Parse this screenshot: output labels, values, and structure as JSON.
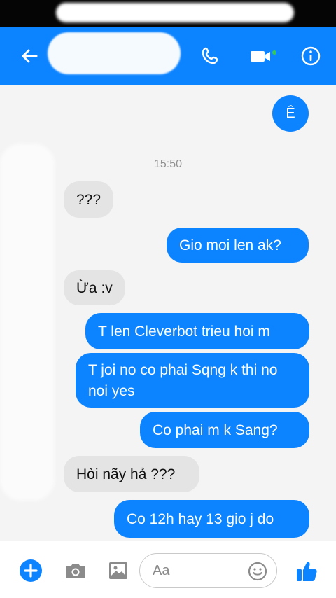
{
  "header": {
    "back_icon": "arrow-left-icon",
    "contact_name": "",
    "actions": [
      "phone-icon",
      "video-icon",
      "info-icon"
    ]
  },
  "conversation": {
    "top_bubble": "Ê",
    "timestamp": "15:50",
    "messages": [
      {
        "direction": "in",
        "text": "???"
      },
      {
        "direction": "out",
        "text": "Gio moi len ak?"
      },
      {
        "direction": "in",
        "text": "Ừa :v"
      },
      {
        "direction": "out",
        "text": "T len Cleverbot trieu hoi m"
      },
      {
        "direction": "out",
        "text": "T joi no co phai Sqng k thi no noi yes"
      },
      {
        "direction": "out",
        "text": "Co phai m k Sang?"
      },
      {
        "direction": "in",
        "text": "Hòi nãy hả ???"
      },
      {
        "direction": "out",
        "text": "Co 12h hay 13 gio j do"
      }
    ]
  },
  "composer": {
    "placeholder": "Aa",
    "icons": [
      "plus-icon",
      "camera-icon",
      "image-icon",
      "emoji-icon",
      "thumbs-up-icon"
    ]
  },
  "colors": {
    "accent": "#0d84ff",
    "incoming_bubble": "#e4e4e4",
    "background": "#f4f4f4"
  }
}
